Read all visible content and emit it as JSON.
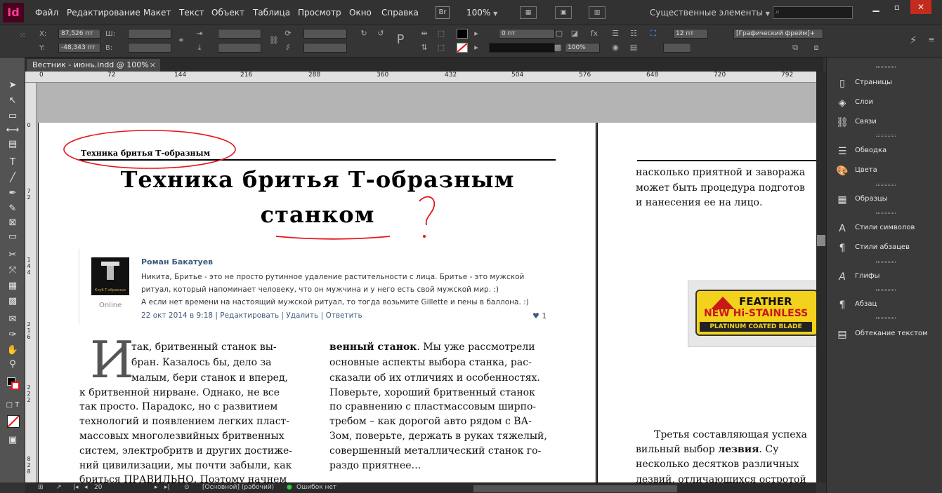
{
  "app": {
    "logo": "Id"
  },
  "menu": [
    "Файл",
    "Редактирование",
    "Макет",
    "Текст",
    "Объект",
    "Таблица",
    "Просмотр",
    "Окно",
    "Справка"
  ],
  "topbar": {
    "bridge_label": "Br",
    "zoom": "100%",
    "workspace": "Существенные элементы"
  },
  "control": {
    "x_label": "X:",
    "y_label": "Y:",
    "w_label": "Ш:",
    "h_label": "В:",
    "x_value": "87,526 пт",
    "y_value": "-48,343 пт",
    "stroke_weight": "0 пт",
    "opacity": "100%",
    "gap": "12 пт",
    "object_style": "[Графический фрейм]+"
  },
  "document_tab": {
    "title": "Вестник - июнь.indd @ 100%",
    "close": "×"
  },
  "ruler_h": [
    "0",
    "72",
    "144",
    "216",
    "288",
    "360",
    "432",
    "504",
    "576",
    "648",
    "720",
    "792"
  ],
  "ruler_v": [
    "0",
    "7",
    "2",
    "1",
    "4",
    "4",
    "2",
    "1",
    "6",
    "2",
    "2",
    "2",
    "8",
    "2",
    "8"
  ],
  "page1": {
    "running_head": "Техника бритья Т-образным",
    "title_line1": "Техника бритья Т-образным",
    "title_line2": "станком",
    "comment": {
      "author": "Роман Бакатуев",
      "avatar_caption": "Клуб Т-образных",
      "status": "Online",
      "lines": [
        "Никита, Бритье - это не просто рутинное удаление растительности с лица. Бритье - это мужской",
        "ритуал, который напоминает человеку, что он мужчина и у него есть свой мужской мир. :)",
        "А если нет времени на настоящий мужской ритуал, то тогда возьмите Gillette и пены в баллона. :)"
      ],
      "meta": "22 окт 2014 в 9:18 | Редактировать | Удалить | Ответить",
      "likes": "1"
    },
    "dropcap": "И",
    "col1": [
      "так, бритвенный станок вы-",
      "бран. Казалось бы, дело за",
      "малым, бери станок и вперед,",
      "к бритвенной нирване. Однако, не все",
      "так просто. Парадокс, но с развитием",
      "технологий и появлением легких пласт-",
      "массовых многолезвийных бритвенных",
      "систем, электробритв и других достиже-",
      "ний цивилизации, мы почти забыли, как",
      "бриться ПРАВИЛЬНО. Поэтому начнем"
    ],
    "col2_bold": "венный станок",
    "col2_first_rest": ". Мы уже рассмотрели",
    "col2": [
      "основные аспекты выбора станка, рас-",
      "сказали об их отличиях и особенностях.",
      "Поверьте, хороший бритвенный станок",
      "по сравнению с пластмассовым ширпо-",
      "требом – как дорогой авто рядом с ВА-",
      "Зом, поверьте, держать в руках тяжелый,",
      "совершенный металлический станок го-",
      "раздо приятнее…"
    ]
  },
  "page2": {
    "top_lines": [
      "насколько приятной и завоража",
      "может быть процедура подготов",
      "и нанесения ее на лицо."
    ],
    "blade": {
      "brand": "FEATHER",
      "line2": "NEW Hi-STAINLESS",
      "line3": "PLATINUM  COATED BLADE"
    },
    "bottom_line1": "Третья составляющая успеха",
    "bottom_line2_pre": "вильный выбор ",
    "bottom_line2_bold": "лезвия",
    "bottom_line2_post": ". Су",
    "bottom_line3": "несколько десятков различных",
    "bottom_line4": "лезвий, отличающихся остротой"
  },
  "panel": [
    "Страницы",
    "Слои",
    "Связи",
    "Обводка",
    "Цвета",
    "Образцы",
    "Стили символов",
    "Стили абзацев",
    "Глифы",
    "Абзац",
    "Обтекание текстом"
  ],
  "status": {
    "page": "20",
    "master": "[Основной] (рабочий)",
    "errors": "Ошибок нет"
  },
  "colors": {
    "annotation": "#e8141c",
    "accent": "#ff3b94",
    "link": "#3b5c7c"
  }
}
